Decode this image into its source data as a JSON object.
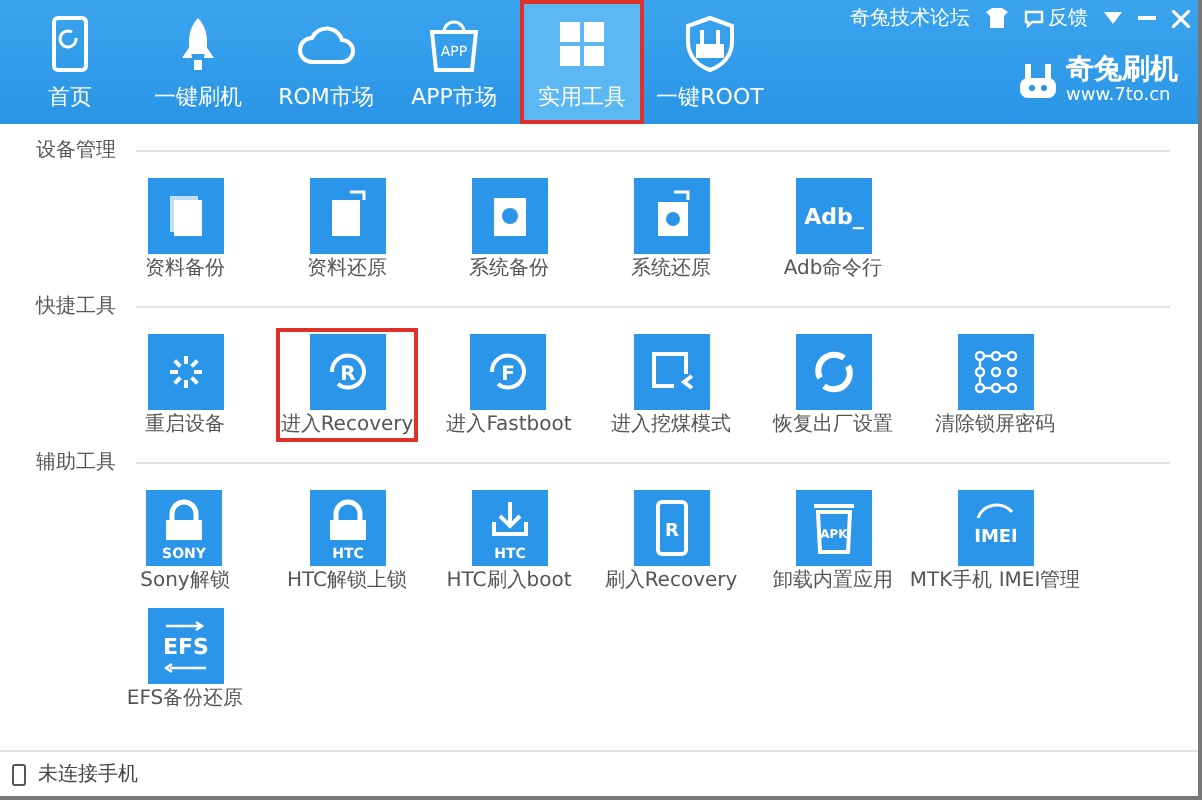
{
  "title_bar": {
    "forum_link": "奇兔技术论坛",
    "feedback": "反馈"
  },
  "nav": [
    {
      "label": "首页",
      "kind": "home",
      "selected": false,
      "marked": false
    },
    {
      "label": "一键刷机",
      "kind": "rocket",
      "selected": false,
      "marked": false
    },
    {
      "label": "ROM市场",
      "kind": "cloud",
      "selected": false,
      "marked": false
    },
    {
      "label": "APP市场",
      "kind": "bag",
      "glyph": "APP",
      "selected": false,
      "marked": false
    },
    {
      "label": "实用工具",
      "kind": "grid",
      "selected": true,
      "marked": true
    },
    {
      "label": "一键ROOT",
      "kind": "shield",
      "selected": false,
      "marked": false
    }
  ],
  "logo": {
    "name": "奇兔刷机",
    "url": "www.7to.cn"
  },
  "sections": [
    {
      "title": "设备管理",
      "tools": [
        {
          "label": "资料备份",
          "kind": "docs",
          "marked": false
        },
        {
          "label": "资料还原",
          "kind": "docs-restore",
          "marked": false
        },
        {
          "label": "系统备份",
          "kind": "gear-doc",
          "marked": false
        },
        {
          "label": "系统还原",
          "kind": "gear-restore",
          "marked": false
        },
        {
          "label": "Adb命令行",
          "kind": "text",
          "glyph": "Adb_",
          "marked": false
        }
      ]
    },
    {
      "title": "快捷工具",
      "tools": [
        {
          "label": "重启设备",
          "kind": "spinner",
          "marked": false
        },
        {
          "label": "进入Recovery",
          "kind": "cycle-letter",
          "glyph": "R",
          "marked": true
        },
        {
          "label": "进入Fastboot",
          "kind": "cycle-letter",
          "glyph": "F",
          "marked": false
        },
        {
          "label": "进入挖煤模式",
          "kind": "screen",
          "marked": false
        },
        {
          "label": "恢复出厂设置",
          "kind": "arrows",
          "marked": false
        },
        {
          "label": "清除锁屏密码",
          "kind": "pattern",
          "marked": false
        }
      ]
    },
    {
      "title": "辅助工具",
      "tools": [
        {
          "label": "Sony解锁",
          "kind": "lock",
          "glyph": "SONY",
          "marked": false
        },
        {
          "label": "HTC解锁上锁",
          "kind": "lock",
          "glyph": "HTC",
          "marked": false
        },
        {
          "label": "HTC刷入boot",
          "kind": "download",
          "glyph": "HTC",
          "marked": false
        },
        {
          "label": "刷入Recovery",
          "kind": "phone",
          "glyph": "R",
          "marked": false
        },
        {
          "label": "卸载内置应用",
          "kind": "bin",
          "glyph": "APK",
          "marked": false
        },
        {
          "label": "MTK手机 IMEI管理",
          "kind": "imei",
          "glyph": "IMEI",
          "marked": false
        },
        {
          "label": "EFS备份还原",
          "kind": "efs",
          "glyph": "EFS",
          "marked": false
        }
      ]
    }
  ],
  "status_bar": {
    "text": "未连接手机"
  }
}
